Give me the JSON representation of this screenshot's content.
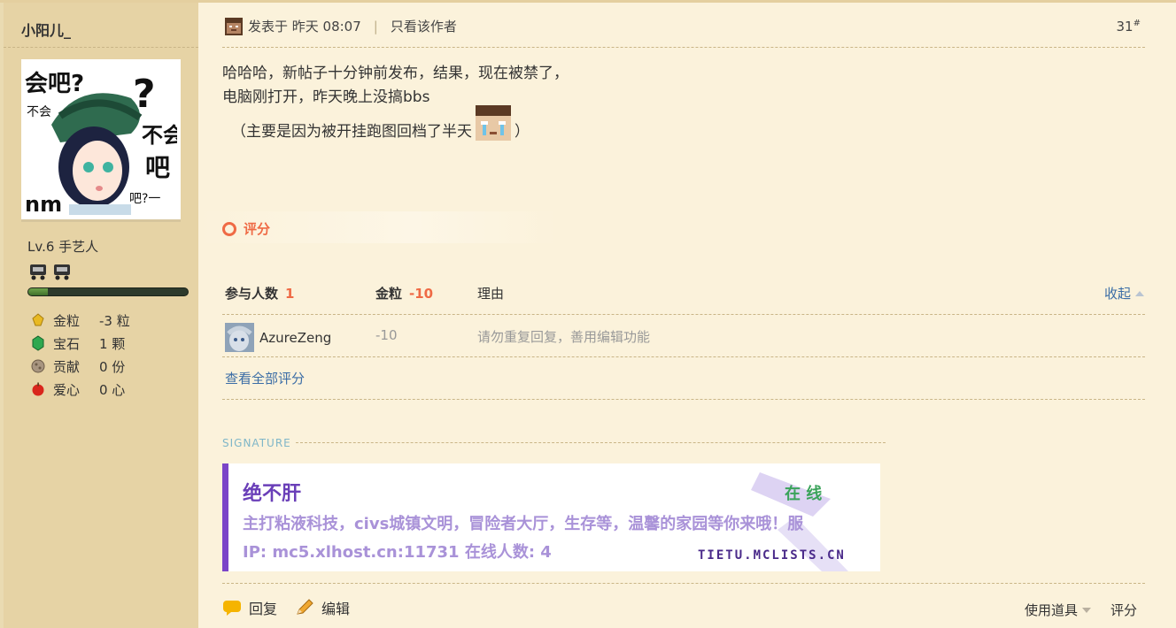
{
  "author": {
    "name": "小阳儿_",
    "level": "Lv.6 手艺人",
    "xp_fraction": 0.12,
    "stats": [
      {
        "icon": "gold-nugget-icon",
        "label": "金粒",
        "value": "-3 粒",
        "color": "#e8b923"
      },
      {
        "icon": "emerald-icon",
        "label": "宝石",
        "value": "1 颗",
        "color": "#2fa84f"
      },
      {
        "icon": "contribution-icon",
        "label": "贡献",
        "value": "0 份",
        "color": "#8a7a66"
      },
      {
        "icon": "apple-icon",
        "label": "爱心",
        "value": "0 心",
        "color": "#d9261c"
      }
    ]
  },
  "post": {
    "posted_label": "发表于 昨天 08:07",
    "author_only_label": "只看该作者",
    "floor_number": "31",
    "floor_suffix": "#",
    "lines": [
      "哈哈哈，新帖子十分钟前发布，结果，现在被禁了，",
      "电脑刚打开，昨天晚上没搞bbs"
    ],
    "note_open": "（主要是因为被开挂跑图回档了半天",
    "note_close": "）"
  },
  "rating": {
    "title": "评分",
    "participants_label": "参与人数",
    "participants_count": "1",
    "gold_label": "金粒",
    "gold_total": "-10",
    "reason_label": "理由",
    "collapse_label": "收起",
    "entries": [
      {
        "user": "AzureZeng",
        "score": "-10",
        "reason": "请勿重复回复，善用编辑功能"
      }
    ],
    "view_all_label": "查看全部评分"
  },
  "signature": {
    "label": "SIGNATURE",
    "title": "绝不肝",
    "online_label": "在 线",
    "description": "主打粘液科技，civs城镇文明，冒险者大厅，生存等，温馨的家园等你来哦！服",
    "ip_line": "IP:  mc5.xlhost.cn:11731     在线人数:  4",
    "site": "TIETU.MCLISTS.CN"
  },
  "actions": {
    "reply_label": "回复",
    "edit_label": "编辑",
    "tools_label": "使用道具",
    "rate_label": "评分"
  },
  "colors": {
    "accent_red": "#ef6a45",
    "link_blue": "#3b6da6",
    "sidebar_bg": "#e6d3a5",
    "post_bg": "#fbf2db"
  }
}
